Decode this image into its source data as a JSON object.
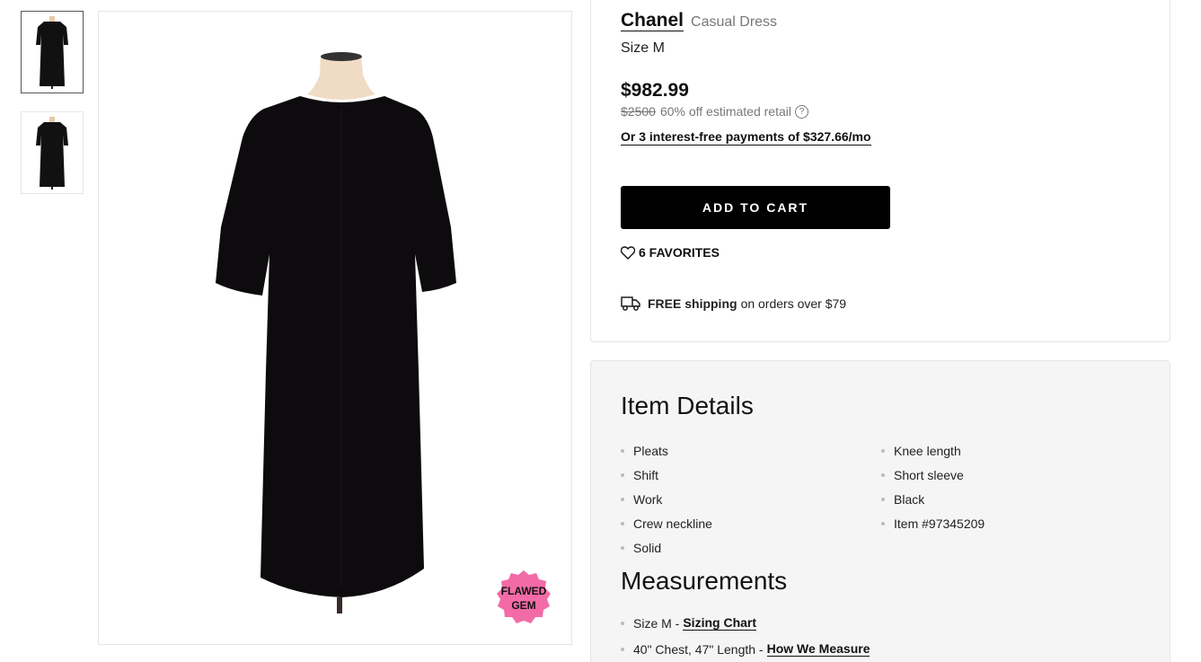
{
  "gallery": {
    "thumbnails": [
      {
        "alt": "dress-front"
      },
      {
        "alt": "dress-back"
      }
    ],
    "badge": {
      "line1": "FLAWED",
      "line2": "GEM",
      "color": "#f36ba6"
    }
  },
  "product": {
    "brand": "Chanel",
    "category": "Casual Dress",
    "size": "Size M",
    "price": "$982.99",
    "retail_price": "$2500",
    "discount_text": "60% off estimated retail",
    "installments": "Or 3 interest-free payments of $327.66/mo",
    "add_to_cart": "ADD TO CART",
    "favorites": "6 FAVORITES",
    "shipping_bold": "FREE shipping",
    "shipping_rest": "on orders over $79"
  },
  "details": {
    "title": "Item Details",
    "left": [
      "Pleats",
      "Shift",
      "Work",
      "Crew neckline",
      "Solid"
    ],
    "right": [
      "Knee length",
      "Short sleeve",
      "Black",
      "Item #97345209"
    ]
  },
  "measurements": {
    "title": "Measurements",
    "items": [
      {
        "text": "Size M -",
        "link": "Sizing Chart"
      },
      {
        "text": "40\" Chest, 47\" Length -",
        "link": "How We Measure"
      }
    ]
  },
  "colors": {
    "accent": "#000000",
    "badge": "#f36ba6",
    "muted": "#777777",
    "details_bg": "#f5f5f5"
  }
}
